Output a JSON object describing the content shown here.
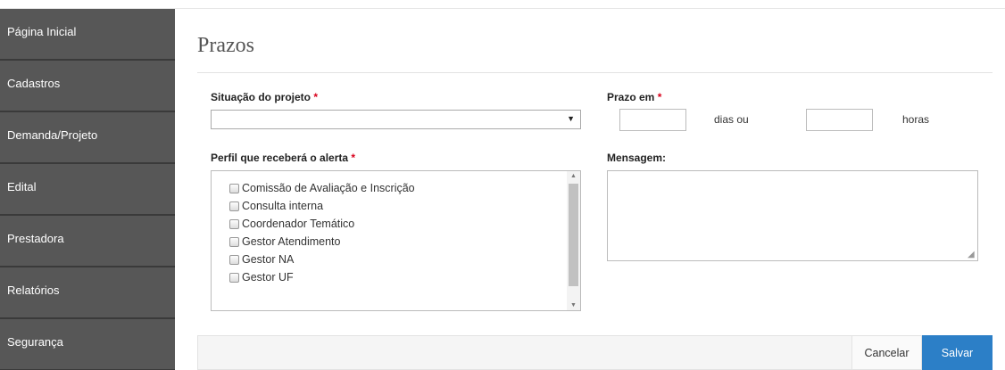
{
  "sidebar": {
    "items": [
      {
        "label": "Página Inicial"
      },
      {
        "label": "Cadastros"
      },
      {
        "label": "Demanda/Projeto"
      },
      {
        "label": "Edital"
      },
      {
        "label": "Prestadora"
      },
      {
        "label": "Relatórios"
      },
      {
        "label": "Segurança"
      }
    ]
  },
  "page": {
    "title": "Prazos"
  },
  "form": {
    "situacao_label": "Situação do projeto",
    "situacao_value": "",
    "required_mark": "*",
    "prazo_label": "Prazo em",
    "dias_value": "",
    "dias_text": "dias ou",
    "horas_value": "",
    "horas_text": "horas",
    "perfil_label": "Perfil que receberá o alerta",
    "perfis": [
      "Comissão de Avaliação e Inscrição",
      "Consulta interna",
      "Coordenador Temático",
      "Gestor Atendimento",
      "Gestor NA",
      "Gestor UF"
    ],
    "mensagem_label": "Mensagem:",
    "mensagem_value": ""
  },
  "actions": {
    "cancel_label": "Cancelar",
    "save_label": "Salvar"
  },
  "colors": {
    "sidebar": "#575757",
    "save": "#2c7fc7",
    "required": "#d9001b"
  }
}
